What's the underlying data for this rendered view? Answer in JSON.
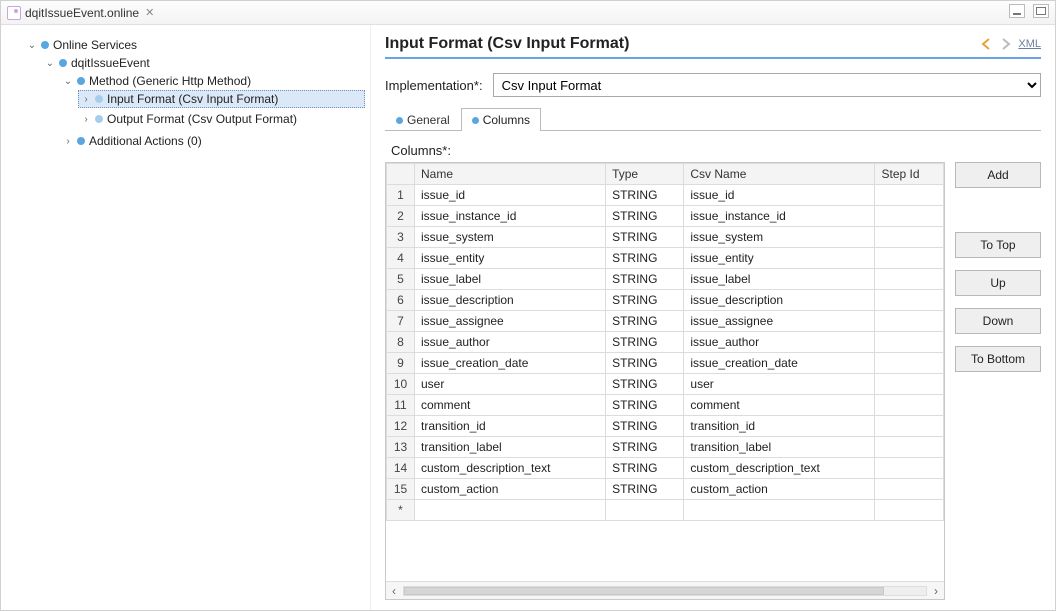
{
  "titlebar": {
    "filename": "dqitIssueEvent.online"
  },
  "tree": {
    "root": {
      "label": "Online Services",
      "expanded": true
    },
    "l1": {
      "label": "dqitIssueEvent",
      "expanded": true
    },
    "method": {
      "label": "Method (Generic Http Method)",
      "expanded": true
    },
    "input_format": {
      "label": "Input Format (Csv Input Format)"
    },
    "output_format": {
      "label": "Output Format (Csv Output Format)"
    },
    "additional_actions": {
      "label": "Additional Actions (0)"
    }
  },
  "main": {
    "heading": "Input Format (Csv Input Format)",
    "xml_label": "XML",
    "impl_label": "Implementation*:",
    "impl_value": "Csv Input Format",
    "tabs": {
      "general": "General",
      "columns": "Columns"
    },
    "columns_label": "Columns*:",
    "table": {
      "headers": {
        "name": "Name",
        "type": "Type",
        "csv_name": "Csv Name",
        "step_id": "Step Id"
      },
      "rows": [
        {
          "n": "1",
          "name": "issue_id",
          "type": "STRING",
          "csv_name": "issue_id",
          "step_id": ""
        },
        {
          "n": "2",
          "name": "issue_instance_id",
          "type": "STRING",
          "csv_name": "issue_instance_id",
          "step_id": ""
        },
        {
          "n": "3",
          "name": "issue_system",
          "type": "STRING",
          "csv_name": "issue_system",
          "step_id": ""
        },
        {
          "n": "4",
          "name": "issue_entity",
          "type": "STRING",
          "csv_name": "issue_entity",
          "step_id": ""
        },
        {
          "n": "5",
          "name": "issue_label",
          "type": "STRING",
          "csv_name": "issue_label",
          "step_id": ""
        },
        {
          "n": "6",
          "name": "issue_description",
          "type": "STRING",
          "csv_name": "issue_description",
          "step_id": ""
        },
        {
          "n": "7",
          "name": "issue_assignee",
          "type": "STRING",
          "csv_name": "issue_assignee",
          "step_id": ""
        },
        {
          "n": "8",
          "name": "issue_author",
          "type": "STRING",
          "csv_name": "issue_author",
          "step_id": ""
        },
        {
          "n": "9",
          "name": "issue_creation_date",
          "type": "STRING",
          "csv_name": "issue_creation_date",
          "step_id": ""
        },
        {
          "n": "10",
          "name": "user",
          "type": "STRING",
          "csv_name": "user",
          "step_id": ""
        },
        {
          "n": "11",
          "name": "comment",
          "type": "STRING",
          "csv_name": "comment",
          "step_id": ""
        },
        {
          "n": "12",
          "name": "transition_id",
          "type": "STRING",
          "csv_name": "transition_id",
          "step_id": ""
        },
        {
          "n": "13",
          "name": "transition_label",
          "type": "STRING",
          "csv_name": "transition_label",
          "step_id": ""
        },
        {
          "n": "14",
          "name": "custom_description_text",
          "type": "STRING",
          "csv_name": "custom_description_text",
          "step_id": ""
        },
        {
          "n": "15",
          "name": "custom_action",
          "type": "STRING",
          "csv_name": "custom_action",
          "step_id": ""
        }
      ],
      "new_row_marker": "*"
    },
    "buttons": {
      "add": "Add",
      "to_top": "To Top",
      "up": "Up",
      "down": "Down",
      "to_bottom": "To Bottom"
    }
  }
}
